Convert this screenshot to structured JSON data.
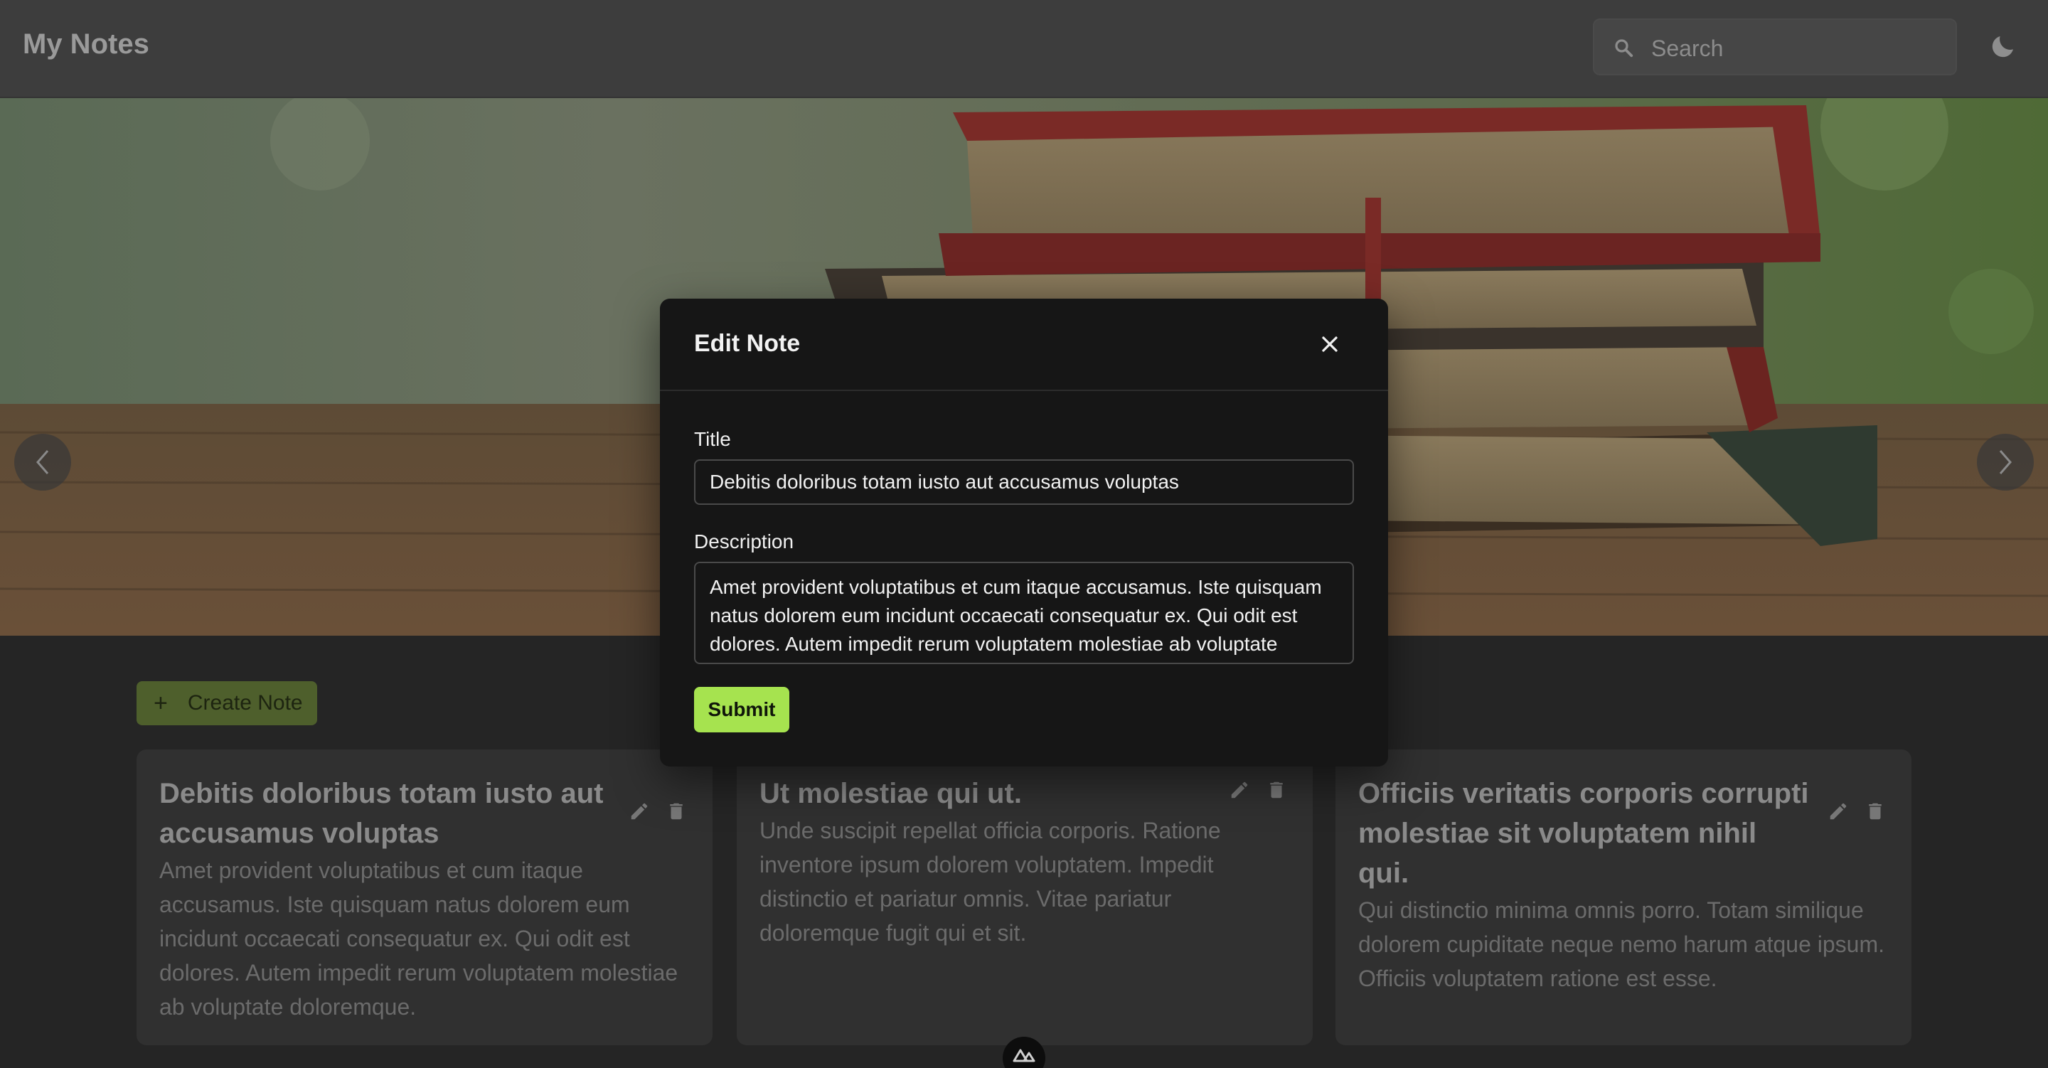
{
  "header": {
    "app_title": "My Notes",
    "search_placeholder": "Search"
  },
  "hero": {
    "prev_label": "previous slide",
    "next_label": "next slide"
  },
  "main": {
    "create_label": "Create Note",
    "notes": [
      {
        "title": "Debitis doloribus totam iusto aut accusamus voluptas",
        "description": "Amet provident voluptatibus et cum itaque accusamus. Iste quisquam natus dolorem eum incidunt occaecati consequatur ex. Qui odit est dolores. Autem impedit rerum voluptatem molestiae ab voluptate doloremque."
      },
      {
        "title": "Ut molestiae qui ut.",
        "description": "Unde suscipit repellat officia corporis. Ratione inventore ipsum dolorem voluptatem. Impedit distinctio et pariatur omnis. Vitae pariatur doloremque fugit qui et sit."
      },
      {
        "title": "Officiis veritatis corporis corrupti molestiae sit voluptatem nihil qui.",
        "description": "Qui distinctio minima omnis porro. Totam similique dolorem cupiditate neque nemo harum atque ipsum. Officiis voluptatem ratione est esse."
      }
    ]
  },
  "modal": {
    "title": "Edit Note",
    "title_label": "Title",
    "title_value": "Debitis doloribus totam iusto aut accusamus voluptas",
    "description_label": "Description",
    "description_value": "Amet provident voluptatibus et cum itaque accusamus. Iste quisquam natus dolorem eum incidunt occaecati consequatur ex. Qui odit est dolores. Autem impedit rerum voluptatem molestiae ab voluptate doloremque.",
    "submit_label": "Submit"
  },
  "colors": {
    "accent": "#a6e34f",
    "background": "#252525",
    "modal": "#161616"
  },
  "icons": [
    "search-icon",
    "moon-icon",
    "chevron-left-icon",
    "chevron-right-icon",
    "plus-icon",
    "pencil-icon",
    "trash-icon",
    "close-icon",
    "nuxt-logo-icon"
  ]
}
